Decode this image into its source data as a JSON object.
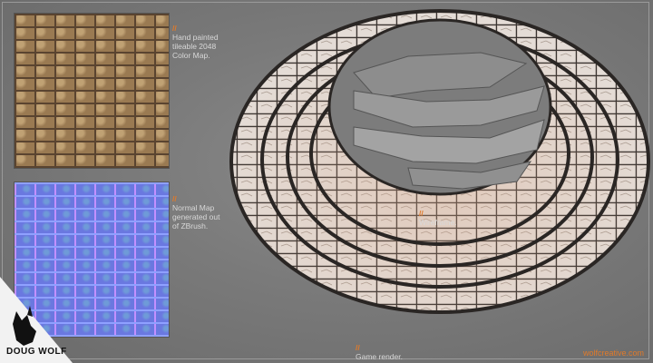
{
  "captions": {
    "color_map": "Hand painted\ntileable 2048\nColor Map.",
    "normal_map": "Normal Map\ngenerated out\nof ZBrush.",
    "wireframe": "Wireframe.",
    "game_render": "Game render."
  },
  "slash": "//",
  "brand": {
    "name": "DOUG WOLF",
    "site": "wolfcreative.com"
  },
  "colors": {
    "accent": "#e07a2a",
    "caption_text": "#d8d8d8"
  },
  "icons": {
    "logo": "wolf-head-icon"
  }
}
